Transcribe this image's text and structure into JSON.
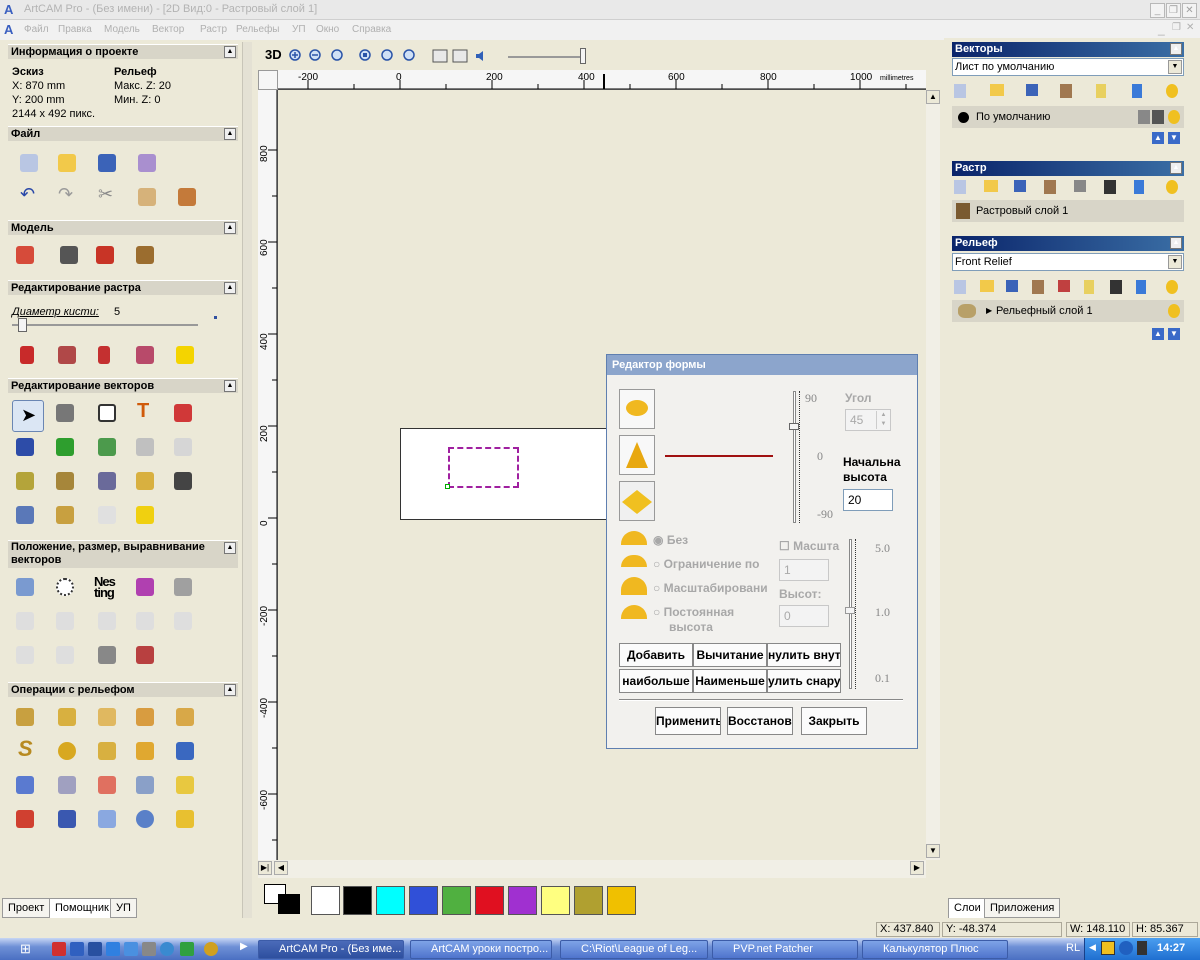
{
  "window": {
    "title": "ArtCAM Pro - (Без имени) - [2D Вид:0 - Растровый слой 1]"
  },
  "menu": [
    "Файл",
    "Правка",
    "Модель",
    "Вектор",
    "Растр",
    "Рельефы",
    "УП",
    "Окно",
    "Справка"
  ],
  "left": {
    "project_info": {
      "title": "Информация о проекте",
      "eskiz": "Эскиз",
      "x": "X: 870 mm",
      "y": "Y: 200 mm",
      "pix": "2144 x 492 пикс.",
      "relief": "Рельеф",
      "maxz": "Макс. Z: 20",
      "minz": "Мин. Z: 0"
    },
    "file": {
      "title": "Файл"
    },
    "model": {
      "title": "Модель"
    },
    "raster_edit": {
      "title": "Редактирование растра",
      "brush_label": "Диаметр кисти:",
      "brush_value": "5"
    },
    "vector_edit": {
      "title": "Редактирование векторов"
    },
    "position": {
      "title": "Положение, размер, выравнивание векторов"
    },
    "relief_ops": {
      "title": "Операции с рельефом"
    },
    "nesting_label": "Nes ting",
    "tabs": [
      "Проект",
      "Помощник",
      "УП"
    ]
  },
  "toolbar": {
    "view3d": "3D"
  },
  "ruler": {
    "unit": "millimetres",
    "top": [
      "-200",
      "0",
      "200",
      "400",
      "600",
      "800",
      "1000"
    ],
    "left": [
      "800",
      "600",
      "400",
      "200",
      "0",
      "-200",
      "-400",
      "-600"
    ]
  },
  "right": {
    "vectors": {
      "title": "Векторы",
      "sheet": "Лист по умолчанию",
      "layer": "По умолчанию"
    },
    "raster": {
      "title": "Растр",
      "layer": "Растровый слой 1"
    },
    "relief": {
      "title": "Рельеф",
      "combo": "Front Relief",
      "layer": "Рельефный слой 1"
    },
    "tabs": [
      "Слои",
      "Приложения"
    ]
  },
  "dialog": {
    "title": "Редактор формы",
    "angle_label": "Угол",
    "angle_value": "45",
    "slider_top": "90",
    "slider_mid": "0",
    "slider_bot": "-90",
    "height_label_1": "Начальна",
    "height_label_2": "высота",
    "height_value": "20",
    "radio_none": "Без",
    "radio_limit": "Ограничение по",
    "radio_scale": "Масштабировани",
    "radio_const": "Постоянная",
    "radio_const2": "высота",
    "scale_chk": "Масшта",
    "scale_value": "1",
    "height2_label": "Высот:",
    "height2_value": "0",
    "scale_top": "5.0",
    "scale_mid": "1.0",
    "scale_bot": "0.1",
    "btn_add": "Добавить",
    "btn_sub": "Вычитание",
    "btn_zero_in": "нулить внут",
    "btn_max": "наибольше",
    "btn_min": "Наименьше",
    "btn_zero_out": "улить снару",
    "btn_apply": "Применить",
    "btn_restore": "Восстанови",
    "btn_close": "Закрыть"
  },
  "palette": [
    "#ffffff",
    "#000000",
    "#00ffff",
    "#3050d8",
    "#50b040",
    "#e01020",
    "#a030d0",
    "#ffff80",
    "#b0a030",
    "#f0c000"
  ],
  "status": {
    "x": "X: 437.840",
    "y": "Y: -48.374",
    "w": "W: 148.110",
    "h": "H: 85.367"
  },
  "taskbar": {
    "tasks": [
      "ArtCAM Pro - (Без име...",
      "ArtCAM уроки постро...",
      "C:\\Riot\\League of Leg...",
      "PVP.net Patcher",
      "Калькулятор Плюс"
    ],
    "lang": "RL",
    "clock": "14:27"
  }
}
